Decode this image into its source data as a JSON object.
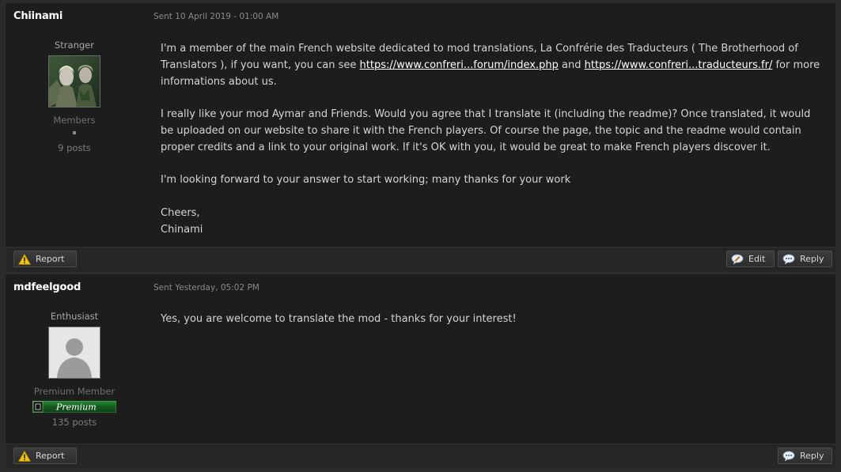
{
  "posts": [
    {
      "author": "Chiinami",
      "sent": "Sent 10 April 2019 - 01:00 AM",
      "rank": "Stranger",
      "group": "Members",
      "posts": "9 posts",
      "avatar_icon": "elf-portrait-avatar",
      "body": {
        "p1_a": "I'm a member of the main French website dedicated to mod translations, La Confrérie des Traducteurs ( The Brotherhood of Translators ), if you want, you can see ",
        "link1": "https://www.confreri...forum/index.php",
        "p1_b": " and ",
        "link2": "https://www.confreri...traducteurs.fr/",
        "p1_c": " for more informations about us.",
        "p2": "I really like your mod Aymar and Friends. Would you agree that I translate it (including the readme)? Once translated, it would be uploaded on our website to share it with the French players. Of course the page, the topic and the readme would contain proper credits and a link to your original work. If it's OK with you, it would be great to make French players discover it.",
        "p3": "I'm looking forward to your answer to start working; many thanks for your work",
        "p4_a": "Cheers,",
        "p4_b": "Chinami"
      },
      "buttons": {
        "report": "Report",
        "edit": "Edit",
        "reply": "Reply"
      }
    },
    {
      "author": "mdfeelgood",
      "sent": "Sent Yesterday, 05:02 PM",
      "rank": "Enthusiast",
      "group": "Premium Member",
      "badge": "Premium",
      "posts": "135 posts",
      "avatar_icon": "default-user-avatar",
      "body": {
        "p1": "Yes, you are welcome to translate the mod - thanks for your interest!"
      },
      "buttons": {
        "report": "Report",
        "reply": "Reply"
      }
    }
  ],
  "colors": {
    "page_bg": "#2b2b2b",
    "post_bg": "#1d1d1d",
    "link": "#ffffff",
    "badge_green": "#1e6b2a"
  }
}
